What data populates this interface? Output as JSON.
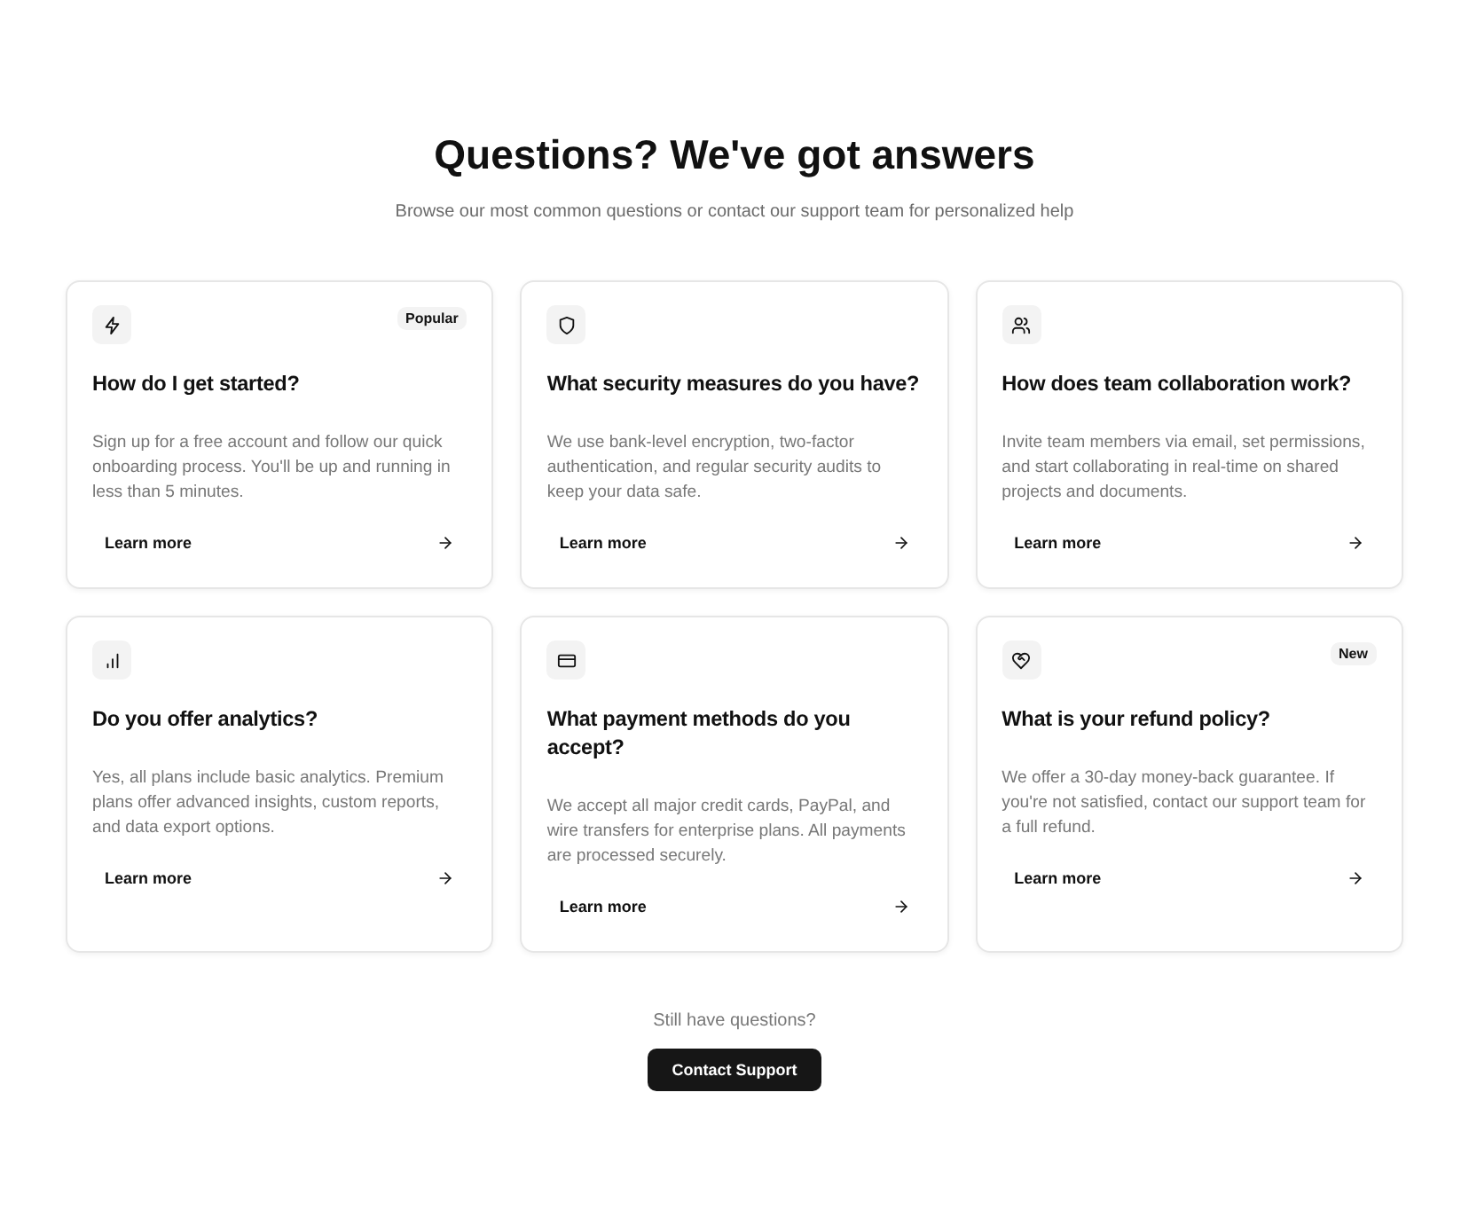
{
  "header": {
    "title": "Questions? We've got answers",
    "subtitle": "Browse our most common questions or contact our support team for personalized help"
  },
  "cards": [
    {
      "badge": "Popular",
      "question": "How do I get started?",
      "answer": "Sign up for a free account and follow our quick onboarding process. You'll be up and running in less than 5 minutes.",
      "link": "Learn more"
    },
    {
      "question": "What security measures do you have?",
      "answer": "We use bank-level encryption, two-factor authentication, and regular security audits to keep your data safe.",
      "link": "Learn more"
    },
    {
      "question": "How does team collaboration work?",
      "answer": "Invite team members via email, set permissions, and start collaborating in real-time on shared projects and documents.",
      "link": "Learn more"
    },
    {
      "question": "Do you offer analytics?",
      "answer": "Yes, all plans include basic analytics. Premium plans offer advanced insights, custom reports, and data export options.",
      "link": "Learn more"
    },
    {
      "question": "What payment methods do you accept?",
      "answer": "We accept all major credit cards, PayPal, and wire transfers for enterprise plans. All payments are processed securely.",
      "link": "Learn more"
    },
    {
      "badge": "New",
      "question": "What is your refund policy?",
      "answer": "We offer a 30-day money-back guarantee. If you're not satisfied, contact our support team for a full refund.",
      "link": "Learn more"
    }
  ],
  "footer": {
    "prompt": "Still have questions?",
    "button": "Contact Support"
  }
}
